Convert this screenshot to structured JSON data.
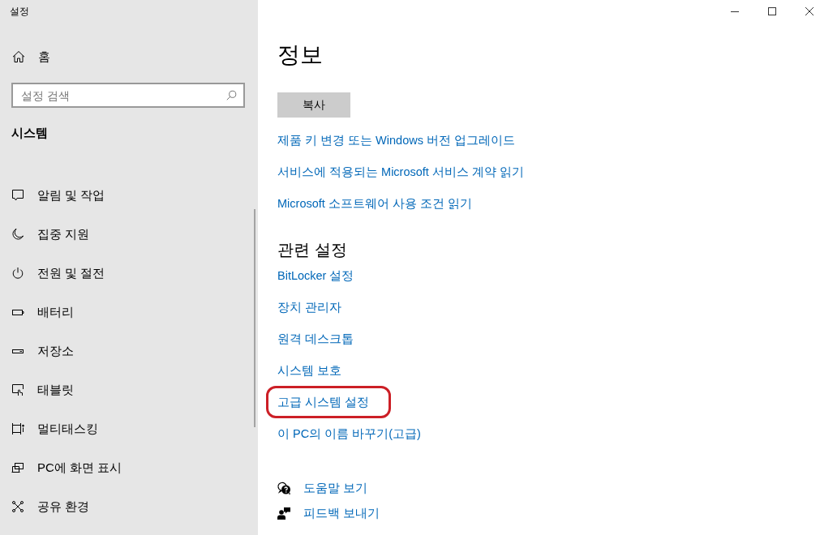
{
  "window": {
    "title": "설정"
  },
  "sidebar": {
    "home": {
      "label": "홈"
    },
    "search": {
      "placeholder": "설정 검색"
    },
    "section_title": "시스템",
    "items": [
      {
        "label": "알림 및 작업",
        "selected": false
      },
      {
        "label": "집중 지원",
        "selected": false
      },
      {
        "label": "전원 및 절전",
        "selected": false
      },
      {
        "label": "배터리",
        "selected": false
      },
      {
        "label": "저장소",
        "selected": false
      },
      {
        "label": "태블릿",
        "selected": false
      },
      {
        "label": "멀티태스킹",
        "selected": false
      },
      {
        "label": "PC에 화면 표시",
        "selected": false
      },
      {
        "label": "공유 환경",
        "selected": false
      }
    ]
  },
  "main": {
    "title": "정보",
    "copy_button": "복사",
    "links": [
      "제품 키 변경 또는 Windows 버전 업그레이드",
      "서비스에 적용되는 Microsoft 서비스 계약 읽기",
      "Microsoft 소프트웨어 사용 조건 읽기"
    ]
  },
  "related_settings": {
    "title": "관련 설정",
    "links": [
      {
        "label": "BitLocker 설정",
        "highlighted": false
      },
      {
        "label": "장치 관리자",
        "highlighted": false
      },
      {
        "label": "원격 데스크톱",
        "highlighted": false
      },
      {
        "label": "시스템 보호",
        "highlighted": false
      },
      {
        "label": "고급 시스템 설정",
        "highlighted": true
      },
      {
        "label": "이 PC의 이름 바꾸기(고급)",
        "highlighted": false
      }
    ]
  },
  "help_links": [
    {
      "label": "도움말 보기"
    },
    {
      "label": "피드백 보내기"
    }
  ]
}
